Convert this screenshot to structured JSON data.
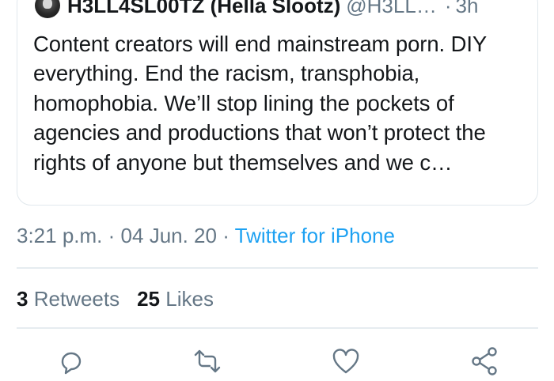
{
  "quoted_tweet": {
    "display_name": "H3LL4SL00TZ (Hella Slootz)",
    "handle": "@H3LL…",
    "separator": "·",
    "time_ago": "3h",
    "text": "Content creators will end mainstream porn. DIY everything. End the racism, transphobia, homophobia. We’ll stop lining the pockets of agencies and productions that won’t protect the rights of anyone but themselves and we c…"
  },
  "meta": {
    "time": "3:21 p.m.",
    "dot1": "·",
    "date": "04 Jun. 20",
    "dot2": "·",
    "source": "Twitter for iPhone"
  },
  "stats": {
    "retweets_count": "3",
    "retweets_label": "Retweets",
    "likes_count": "25",
    "likes_label": "Likes"
  },
  "actions": {
    "reply_icon": "reply-icon",
    "retweet_icon": "retweet-icon",
    "like_icon": "heart-icon",
    "share_icon": "share-icon"
  },
  "colors": {
    "text": "#14171a",
    "secondary": "#657786",
    "link": "#1da1f2",
    "border": "#e1e8ed"
  }
}
